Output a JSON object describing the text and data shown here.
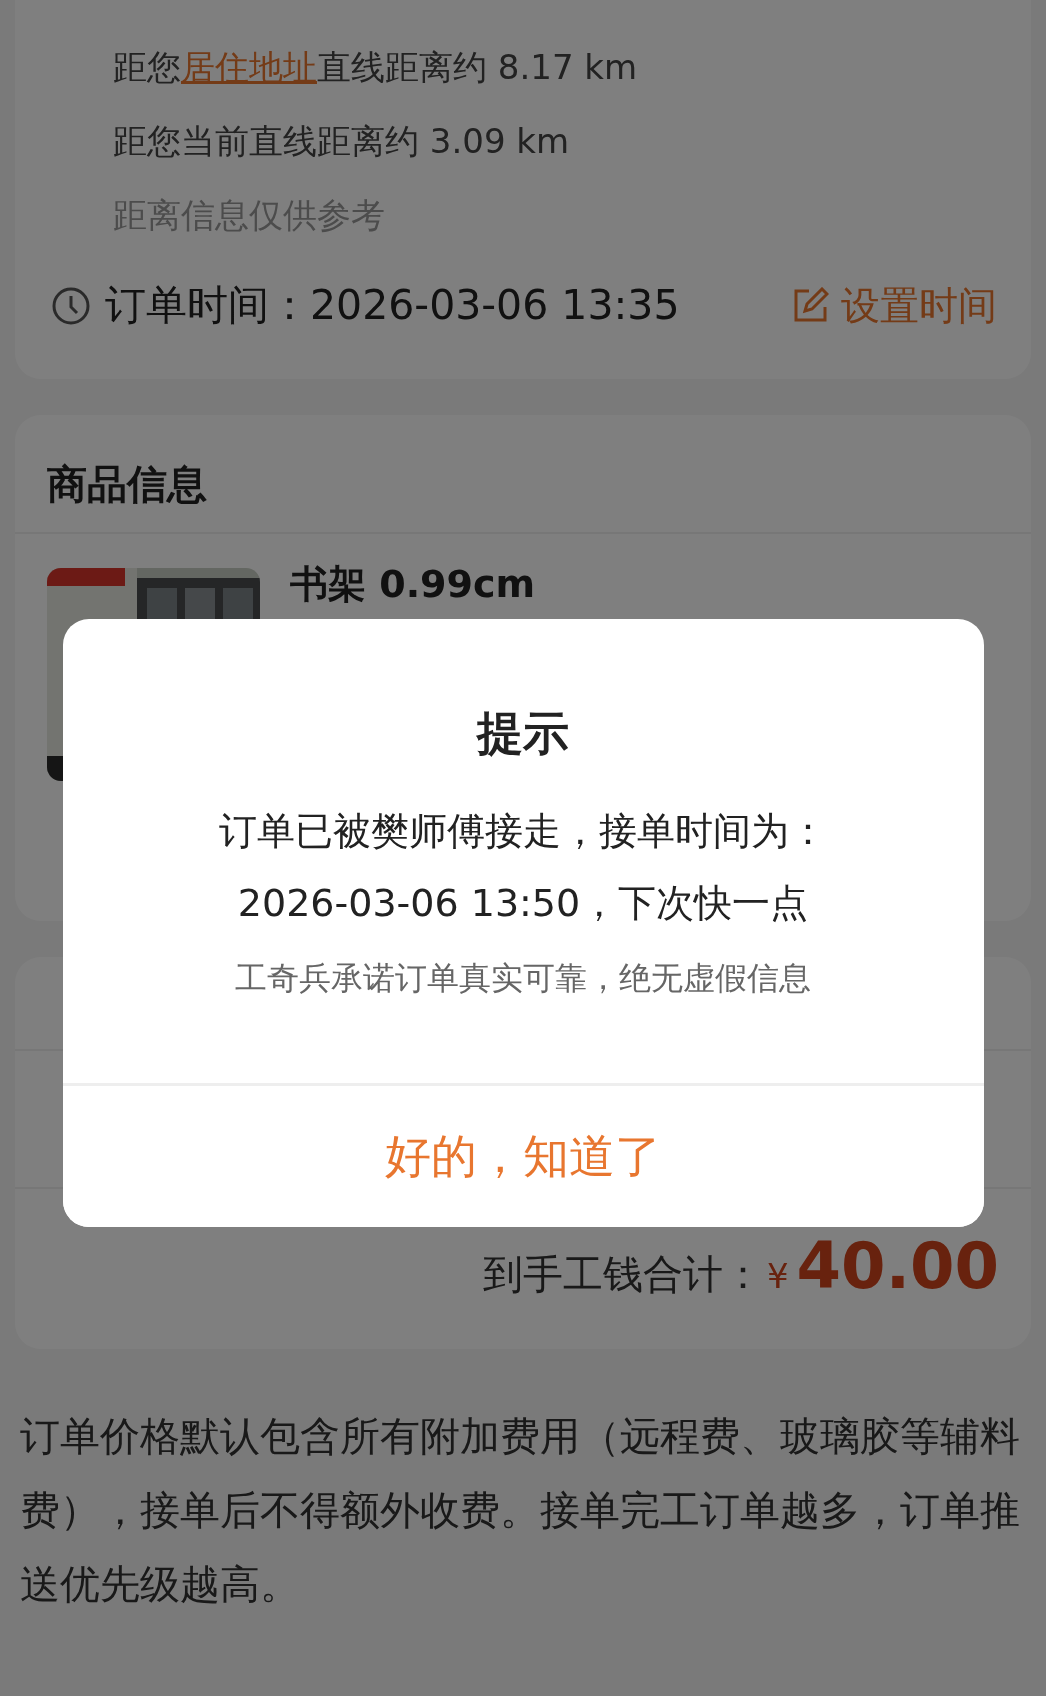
{
  "distance": {
    "residence": {
      "prefix": "距您",
      "link": "居住地址",
      "suffix": "直线距离约 8.17 km"
    },
    "current": "距您当前直线距离约 3.09 km",
    "note": "距离信息仅供参考"
  },
  "order_time": {
    "label": "订单时间：2026-03-06 13:35",
    "action": "设置时间"
  },
  "product_section": {
    "title": "商品信息",
    "products": [
      {
        "kind": "picture",
        "name": "书架 0.99cm"
      }
    ]
  },
  "total": {
    "label": "到手工钱合计：",
    "currency": "¥",
    "amount": "40.00"
  },
  "notice": "订单价格默认包含所有附加费用（远程费、玻璃胶等辅料费），接单后不得额外收费。接单完工订单越多，订单推送优先级越高。",
  "dialog": {
    "title": "提示",
    "message_lines": [
      "订单已被樊师傅接走，接单时间为：",
      "2026-03-06 13:50，下次快一点"
    ],
    "note": "工奇兵承诺订单真实可靠，绝无虚假信息",
    "button": "好的，知道了"
  }
}
